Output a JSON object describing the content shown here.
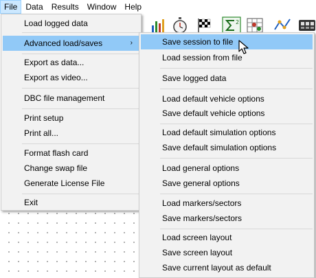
{
  "menubar": {
    "items": [
      "File",
      "Data",
      "Results",
      "Window",
      "Help"
    ]
  },
  "file_menu": {
    "items": [
      "Load logged data",
      "Advanced load/saves",
      "Export as data...",
      "Export as video...",
      "DBC file management",
      "Print setup",
      "Print all...",
      "Format flash card",
      "Change swap file",
      "Generate License File",
      "Exit"
    ],
    "submenu_arrow": "›"
  },
  "submenu": {
    "items": [
      "Save session to file",
      "Load session from file",
      "Save logged data",
      "Load default vehicle options",
      "Save default vehicle options",
      "Load default simulation options",
      "Save default simulation options",
      "Load general options",
      "Save general options",
      "Load markers/sectors",
      "Save markers/sectors",
      "Load screen layout",
      "Save screen layout",
      "Save current layout as default"
    ]
  },
  "toolbar": {
    "icons": [
      "bar-chart-icon",
      "stopwatch-icon",
      "checkered-flag-icon",
      "sigma-squared-icon",
      "grid-table-icon",
      "graph-nodes-icon",
      "film-icon"
    ]
  },
  "colors": {
    "highlight": "#91c9f7",
    "menubar_active": "#cce8ff",
    "menu_bg": "#f2f2f2"
  }
}
